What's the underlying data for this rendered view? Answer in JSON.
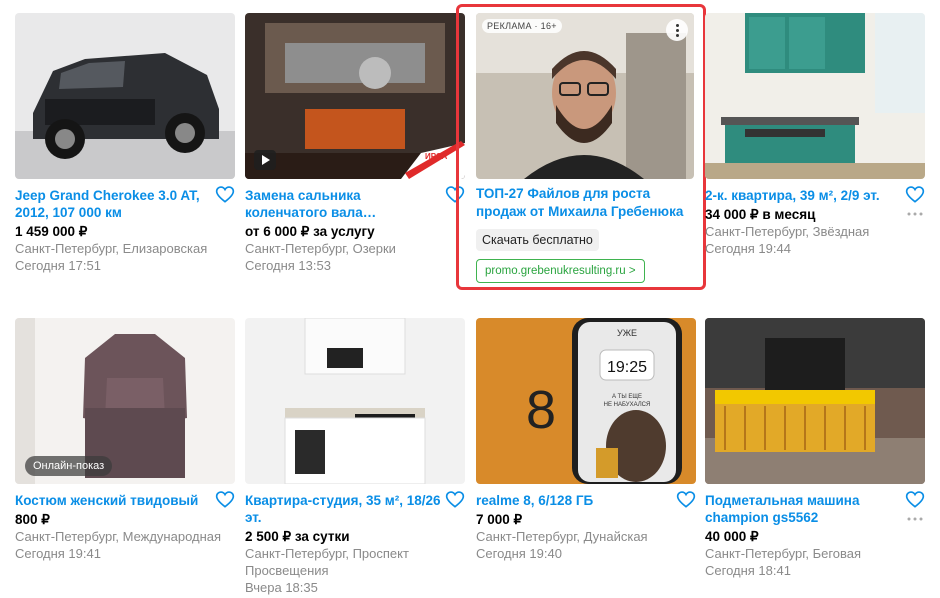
{
  "listings": [
    {
      "title": "Jeep Grand Cherokee 3.0 AT, 2012, 107 000 км",
      "price": "1 459 000 ₽",
      "location": "Санкт-Петербург, Елизаровская",
      "date": "Сегодня 17:51"
    },
    {
      "title": "Замена сальника коленчатого вала…",
      "price": "от 6 000 ₽ за услугу",
      "location": "Санкт-Петербург, Озерки",
      "date": "Сегодня 13:53"
    },
    {
      "title": "2-к. квартира, 39 м², 2/9 эт.",
      "price": "34 000 ₽ в месяц",
      "location": "Санкт-Петербург, Звёздная",
      "date": "Сегодня 19:44"
    },
    {
      "title": "Костюм женский твидовый",
      "price": "800 ₽",
      "location": "Санкт-Петербург, Международная",
      "date": "Сегодня 19:41",
      "badge": "Онлайн-показ"
    },
    {
      "title": "Квартира-студия, 35 м², 18/26 эт.",
      "price": "2 500 ₽ за сутки",
      "location": "Санкт-Петербург, Проспект Просвещения",
      "date": "Вчера 18:35"
    },
    {
      "title": "realme 8, 6/128 ГБ",
      "price": "7 000 ₽",
      "location": "Санкт-Петербург, Дунайская",
      "date": "Сегодня 19:40",
      "photo_text": [
        "УЖЕ",
        "19:25",
        "А ТЫ ЕЩЕ",
        "НЕ НАБУХАЛСЯ",
        "8"
      ]
    },
    {
      "title": "Подметальная машина champion gs5562",
      "price": "40 000 ₽",
      "location": "Санкт-Петербург, Беговая",
      "date": "Сегодня 18:41"
    }
  ],
  "ad": {
    "label": "РЕКЛАМА · 16+",
    "title": "ТОП-27 Файлов для роста продаж от Михаила Гребенюка",
    "cta": "Скачать бесплатно",
    "link": "promo.grebenukresulting.ru >"
  },
  "engine_sign": "ИРСА",
  "colors": {
    "link": "#0a8ee6",
    "ad_border": "#e8363b",
    "ad_link": "#2aa43f",
    "meta": "#8a8a8a"
  }
}
